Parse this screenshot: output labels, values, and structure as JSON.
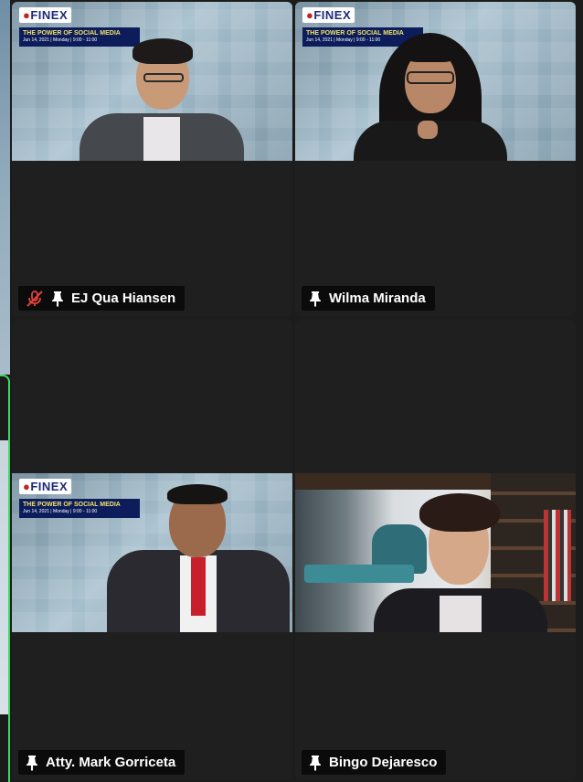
{
  "meeting": {
    "participants": [
      {
        "name": "EJ Qua Hiansen",
        "muted": true,
        "pinned": true,
        "background": "social",
        "overlay": {
          "logo": "FINEX",
          "banner_title": "THE POWER OF SOCIAL MEDIA",
          "banner_sub": "Jun 14, 2021 | Monday | 9:00 - 11:00"
        }
      },
      {
        "name": "Wilma Miranda",
        "muted": false,
        "pinned": true,
        "background": "social",
        "overlay": {
          "logo": "FINEX",
          "banner_title": "THE POWER OF SOCIAL MEDIA",
          "banner_sub": "Jun 14, 2021 | Monday | 9:00 - 11:00"
        }
      },
      {
        "name": "Atty. Mark Gorriceta",
        "muted": false,
        "pinned": true,
        "background": "social",
        "overlay": {
          "logo": "FINEX",
          "banner_title": "THE POWER OF SOCIAL MEDIA",
          "banner_sub": "Jun 14, 2021 | Monday | 9:00 - 11:00"
        }
      },
      {
        "name": "Bingo Dejaresco",
        "muted": false,
        "pinned": true,
        "background": "room"
      }
    ]
  },
  "icons": {
    "mute": "microphone-muted-icon",
    "pin": "pin-icon"
  },
  "colors": {
    "active_speaker_border": "#3ddc5f",
    "mute_icon": "#e0413c",
    "tile_bg": "#1f1f1f",
    "name_tag_bg": "#080808"
  }
}
